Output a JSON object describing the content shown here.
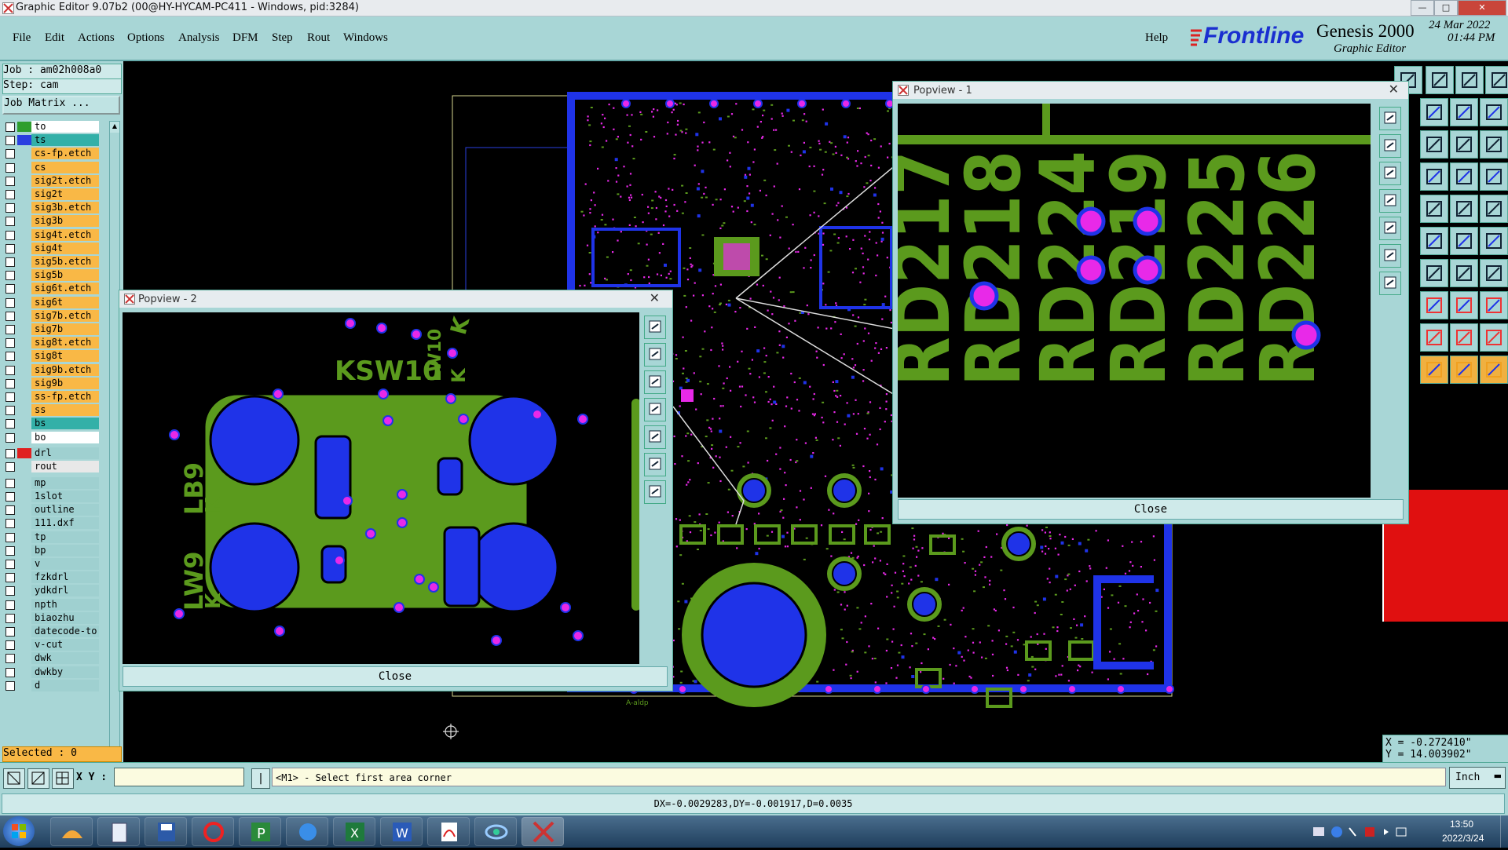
{
  "window": {
    "title": "Graphic Editor 9.07b2 (00@HY-HYCAM-PC411 - Windows, pid:3284)"
  },
  "menu": {
    "items": [
      "File",
      "Edit",
      "Actions",
      "Options",
      "Analysis",
      "DFM",
      "Step",
      "Rout",
      "Windows"
    ],
    "help": "Help"
  },
  "brand": {
    "logo": "Frontline",
    "product": "Genesis 2000",
    "subtitle": "Graphic Editor",
    "date": "24 Mar 2022",
    "time": "01:44 PM"
  },
  "job": {
    "job_label": "Job : am02h008a0",
    "step_label": "Step: cam",
    "matrix_button": "Job Matrix ...",
    "selected": "Selected : 0"
  },
  "layers": [
    {
      "name": "to",
      "color": "#2e9e2e",
      "bg": "#ffffff"
    },
    {
      "name": "ts",
      "color": "#2a3fe0",
      "bg": "#33b0a8"
    },
    {
      "name": "cs-fp.etch",
      "color": "#a8d6d6",
      "bg": "#f9b846"
    },
    {
      "name": "cs",
      "color": "#a8d6d6",
      "bg": "#f9b846"
    },
    {
      "name": "sig2t.etch",
      "color": "#a8d6d6",
      "bg": "#f9b846"
    },
    {
      "name": "sig2t",
      "color": "#a8d6d6",
      "bg": "#f9b846"
    },
    {
      "name": "sig3b.etch",
      "color": "#a8d6d6",
      "bg": "#f9b846"
    },
    {
      "name": "sig3b",
      "color": "#a8d6d6",
      "bg": "#f9b846"
    },
    {
      "name": "sig4t.etch",
      "color": "#a8d6d6",
      "bg": "#f9b846"
    },
    {
      "name": "sig4t",
      "color": "#a8d6d6",
      "bg": "#f9b846"
    },
    {
      "name": "sig5b.etch",
      "color": "#a8d6d6",
      "bg": "#f9b846"
    },
    {
      "name": "sig5b",
      "color": "#a8d6d6",
      "bg": "#f9b846"
    },
    {
      "name": "sig6t.etch",
      "color": "#a8d6d6",
      "bg": "#f9b846"
    },
    {
      "name": "sig6t",
      "color": "#a8d6d6",
      "bg": "#f9b846"
    },
    {
      "name": "sig7b.etch",
      "color": "#a8d6d6",
      "bg": "#f9b846"
    },
    {
      "name": "sig7b",
      "color": "#a8d6d6",
      "bg": "#f9b846"
    },
    {
      "name": "sig8t.etch",
      "color": "#a8d6d6",
      "bg": "#f9b846"
    },
    {
      "name": "sig8t",
      "color": "#a8d6d6",
      "bg": "#f9b846"
    },
    {
      "name": "sig9b.etch",
      "color": "#a8d6d6",
      "bg": "#f9b846"
    },
    {
      "name": "sig9b",
      "color": "#a8d6d6",
      "bg": "#f9b846"
    },
    {
      "name": "ss-fp.etch",
      "color": "#a8d6d6",
      "bg": "#f9b846"
    },
    {
      "name": "ss",
      "color": "#a8d6d6",
      "bg": "#f9b846"
    },
    {
      "name": "bs",
      "color": "#a8d6d6",
      "bg": "#33b0a8"
    },
    {
      "name": "bo",
      "color": "#a8d6d6",
      "bg": "#ffffff"
    },
    {
      "name": "drl",
      "color": "#e02020",
      "bg": "#9fd0d0"
    },
    {
      "name": "rout",
      "color": "#a8d6d6",
      "bg": "#e8e8e8"
    },
    {
      "name": "mp",
      "color": "#a8d6d6",
      "bg": "#9fd0d0"
    },
    {
      "name": "1slot",
      "color": "#a8d6d6",
      "bg": "#9fd0d0"
    },
    {
      "name": "outline",
      "color": "#a8d6d6",
      "bg": "#9fd0d0"
    },
    {
      "name": "111.dxf",
      "color": "#a8d6d6",
      "bg": "#9fd0d0"
    },
    {
      "name": "tp",
      "color": "#a8d6d6",
      "bg": "#9fd0d0"
    },
    {
      "name": "bp",
      "color": "#a8d6d6",
      "bg": "#9fd0d0"
    },
    {
      "name": "v",
      "color": "#a8d6d6",
      "bg": "#9fd0d0"
    },
    {
      "name": "fzkdrl",
      "color": "#a8d6d6",
      "bg": "#9fd0d0"
    },
    {
      "name": "ydkdrl",
      "color": "#a8d6d6",
      "bg": "#9fd0d0"
    },
    {
      "name": "npth",
      "color": "#a8d6d6",
      "bg": "#9fd0d0"
    },
    {
      "name": "biaozhu",
      "color": "#a8d6d6",
      "bg": "#9fd0d0"
    },
    {
      "name": "datecode-to",
      "color": "#a8d6d6",
      "bg": "#9fd0d0"
    },
    {
      "name": "v-cut",
      "color": "#a8d6d6",
      "bg": "#9fd0d0"
    },
    {
      "name": "dwk",
      "color": "#a8d6d6",
      "bg": "#9fd0d0"
    },
    {
      "name": "dwkby",
      "color": "#a8d6d6",
      "bg": "#9fd0d0"
    },
    {
      "name": "d",
      "color": "#a8d6d6",
      "bg": "#9fd0d0"
    }
  ],
  "popview1": {
    "title": "Popview - 1",
    "close": "Close",
    "labels": [
      "RD217",
      "RD218",
      "RD224",
      "RD219",
      "RD225",
      "RD226"
    ]
  },
  "popview2": {
    "title": "Popview - 2",
    "close": "Close",
    "labels": [
      "KSW10",
      "LW10",
      "K",
      "LB9",
      "K",
      "LW9",
      "K",
      "K"
    ]
  },
  "coords": {
    "x": "X = -0.272410\"",
    "y": "Y = 14.003902\""
  },
  "command": {
    "xy_label": "X Y :",
    "xy_value": "",
    "prompt": "<M1> - Select first area corner",
    "units": "Inch"
  },
  "status": {
    "delta": "DX=-0.0029283,DY=-0.001917,D=0.0035"
  },
  "taskbar": {
    "time": "13:50",
    "date": "2022/3/24"
  },
  "board": {
    "silk_label": "A-aldp"
  },
  "colors": {
    "panel": "#a8d6d6",
    "copper": "#5b9a1d",
    "pad": "#1f33e8",
    "via": "#e829e8",
    "drl": "#e02020"
  }
}
